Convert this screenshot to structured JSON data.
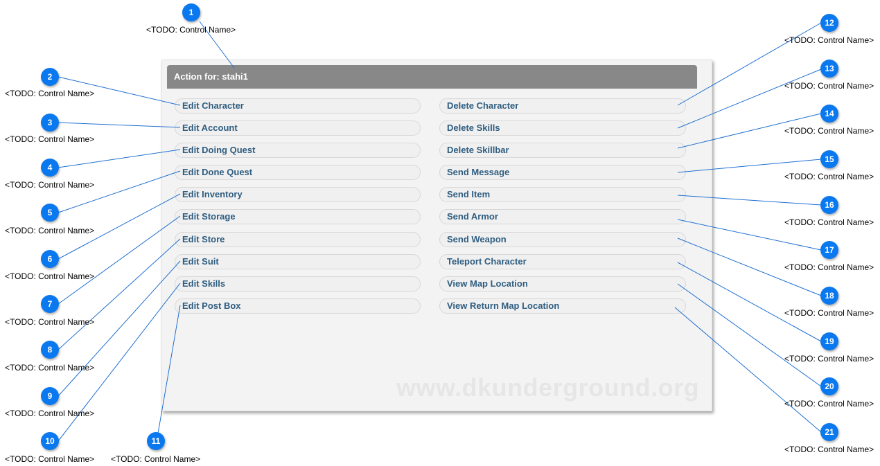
{
  "panel": {
    "header": "Action for: stahi1",
    "watermark": "www.dkunderground.org"
  },
  "actions_left": [
    "Edit Character",
    "Edit Account",
    "Edit Doing Quest",
    "Edit Done Quest",
    "Edit Inventory",
    "Edit Storage",
    "Edit Store",
    "Edit Suit",
    "Edit Skills",
    "Edit Post Box"
  ],
  "actions_right": [
    "Delete Character",
    "Delete Skills",
    "Delete Skillbar",
    "Send Message",
    "Send Item",
    "Send Armor",
    "Send Weapon",
    "Teleport Character",
    "View Map Location",
    "View Return Map Location"
  ],
  "callouts": [
    {
      "number": "1",
      "name": "<TODO: Control Name>"
    },
    {
      "number": "2",
      "name": "<TODO: Control Name>"
    },
    {
      "number": "3",
      "name": "<TODO: Control Name>"
    },
    {
      "number": "4",
      "name": "<TODO: Control Name>"
    },
    {
      "number": "5",
      "name": "<TODO: Control Name>"
    },
    {
      "number": "6",
      "name": "<TODO: Control Name>"
    },
    {
      "number": "7",
      "name": "<TODO: Control Name>"
    },
    {
      "number": "8",
      "name": "<TODO: Control Name>"
    },
    {
      "number": "9",
      "name": "<TODO: Control Name>"
    },
    {
      "number": "10",
      "name": "<TODO: Control Name>"
    },
    {
      "number": "11",
      "name": "<TODO: Control Name>"
    },
    {
      "number": "12",
      "name": "<TODO: Control Name>"
    },
    {
      "number": "13",
      "name": "<TODO: Control Name>"
    },
    {
      "number": "14",
      "name": "<TODO: Control Name>"
    },
    {
      "number": "15",
      "name": "<TODO: Control Name>"
    },
    {
      "number": "16",
      "name": "<TODO: Control Name>"
    },
    {
      "number": "17",
      "name": "<TODO: Control Name>"
    },
    {
      "number": "18",
      "name": "<TODO: Control Name>"
    },
    {
      "number": "19",
      "name": "<TODO: Control Name>"
    },
    {
      "number": "20",
      "name": "<TODO: Control Name>"
    },
    {
      "number": "21",
      "name": "<TODO: Control Name>"
    }
  ],
  "colors": {
    "badge": "#0a78ef",
    "callout_line": "#1f6fd0",
    "header": "#888888",
    "button_text": "#2e5d80"
  }
}
